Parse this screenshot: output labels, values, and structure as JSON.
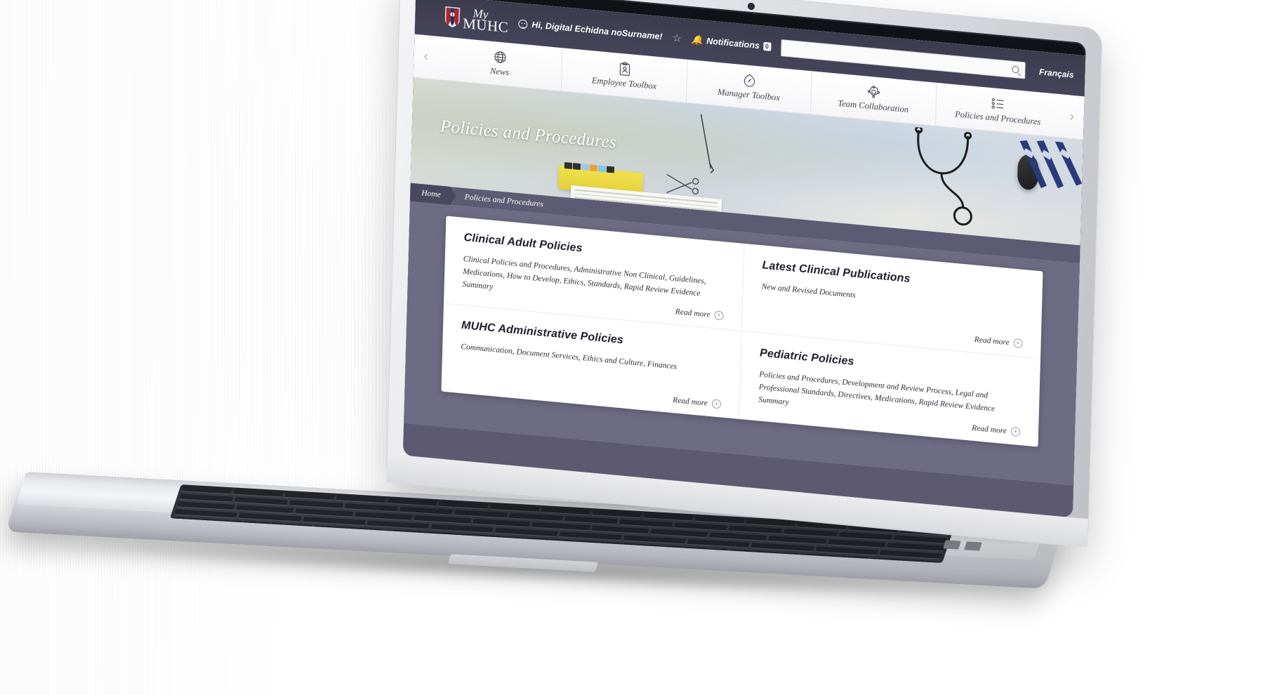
{
  "topbar": {
    "logo_alt": "My MUHC",
    "logo_line1": "My",
    "logo_line2": "MUHC",
    "greeting": "Hi, Digital Echidna noSurname!",
    "favorite_icon": "star-icon",
    "notifications_label": "Notifications",
    "notifications_count": "0",
    "search_value": "",
    "search_placeholder": "",
    "language_toggle": "Français"
  },
  "nav": {
    "prev_label": "‹",
    "next_label": "›",
    "items": [
      {
        "label": "News",
        "icon": "globe-icon"
      },
      {
        "label": "Employee Toolbox",
        "icon": "clipboard-person-icon"
      },
      {
        "label": "Manager Toolbox",
        "icon": "compass-icon"
      },
      {
        "label": "Team Collaboration",
        "icon": "target-team-icon"
      },
      {
        "label": "Policies and Procedures",
        "icon": "bullet-list-icon"
      }
    ]
  },
  "hero": {
    "title": "Policies and Procedures"
  },
  "breadcrumb": {
    "home": "Home",
    "current": "Policies and Procedures"
  },
  "cards": [
    {
      "title": "Clinical Adult Policies",
      "description": "Clinical Policies and Procedures, Administrative Non Clinical, Guidelines, Medications, How to Develop, Ethics, Standards, Rapid Review Evidence Summary",
      "read_more": "Read more"
    },
    {
      "title": "Latest Clinical Publications",
      "description": "New and Revised Documents",
      "read_more": "Read more"
    },
    {
      "title": "MUHC Administrative Policies",
      "description": "Communication, Document Services, Ethics and Culture, Finances",
      "read_more": "Read more"
    },
    {
      "title": "Pediatric Policies",
      "description": "Policies and Procedures, Development and Review Process, Legal and Professional Standards, Directives, Medications, Rapid Review Evidence Summary",
      "read_more": "Read more"
    }
  ],
  "colors": {
    "topbar": "#3d3c4e",
    "breadcrumb": "#5d5b73",
    "page_background": "#6e6b84",
    "card_background": "#ffffff",
    "text_dark": "#1d1d2b",
    "crest_red": "#b2242c"
  }
}
